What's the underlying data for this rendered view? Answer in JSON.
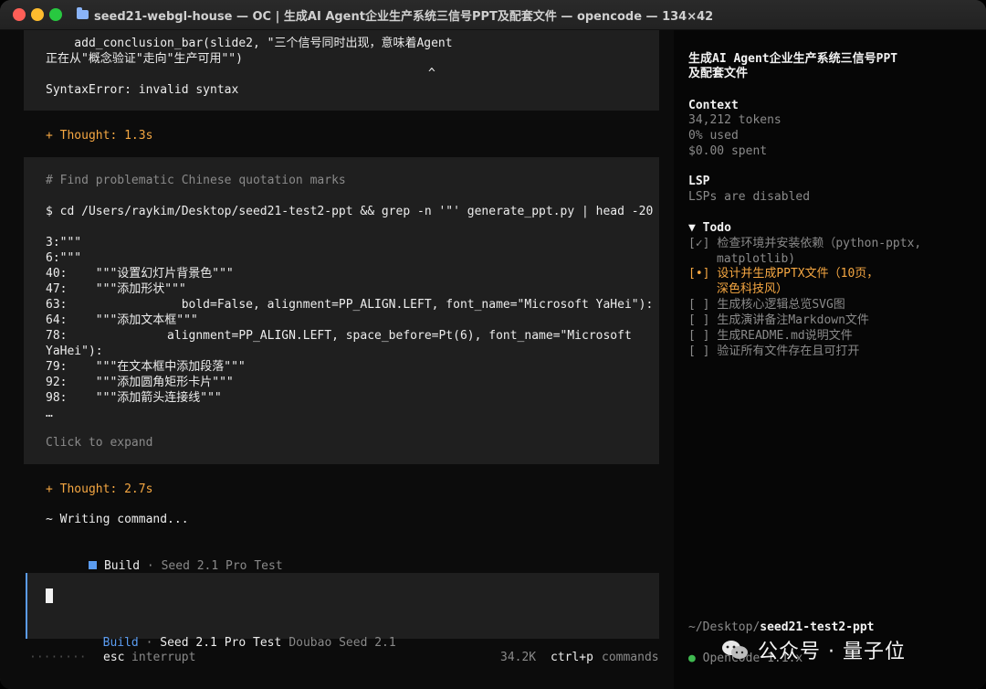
{
  "window": {
    "title": "seed21-webgl-house — OC | 生成AI Agent企业生产系统三信号PPT及配套文件 — opencode — 134×42"
  },
  "main": {
    "error_block": {
      "line1": "    add_conclusion_bar(slide2, \"三个信号同时出现，意味着Agent",
      "line2": "正在从\"概念验证\"走向\"生产可用\"\")",
      "caret": "^",
      "error": "SyntaxError: invalid syntax"
    },
    "thought1": "+ Thought: 1.3s",
    "cmd_block": {
      "comment": "# Find problematic Chinese quotation marks",
      "command": "$ cd /Users/raykim/Desktop/seed21-test2-ppt && grep -n '\"' generate_ppt.py | head -20",
      "out": [
        "3:\"\"\"",
        "6:\"\"\"",
        "40:    \"\"\"设置幻灯片背景色\"\"\"",
        "47:    \"\"\"添加形状\"\"\"",
        "63:                bold=False, alignment=PP_ALIGN.LEFT, font_name=\"Microsoft YaHei\"):",
        "64:    \"\"\"添加文本框\"\"\"",
        "78:              alignment=PP_ALIGN.LEFT, space_before=Pt(6), font_name=\"Microsoft",
        "YaHei\"):",
        "79:    \"\"\"在文本框中添加段落\"\"\"",
        "92:    \"\"\"添加圆角矩形卡片\"\"\"",
        "98:    \"\"\"添加箭头连接线\"\"\"",
        "…"
      ],
      "expand": "Click to expand"
    },
    "thought2": "+ Thought: 2.7s",
    "writing": "~ Writing command...",
    "build_line": {
      "label": "Build",
      "sep": " · ",
      "model": "Seed 2.1 Pro Test"
    },
    "input": {
      "mode": "Build",
      "sep": " · ",
      "model": "Seed 2.1 Pro Test",
      "provider": "Doubao Seed 2.1"
    },
    "status": {
      "dots": "········",
      "esc_key": "esc",
      "esc_label": "interrupt",
      "tokens": "34.2K",
      "cmd_key": "ctrl+p",
      "cmd_label": "commands"
    }
  },
  "sidebar": {
    "title1": "生成AI Agent企业生产系统三信号PPT",
    "title2": "及配套文件",
    "context_header": "Context",
    "context_tokens": "34,212 tokens",
    "context_used": "0% used",
    "context_spent": "$0.00 spent",
    "lsp_header": "LSP",
    "lsp_status": "LSPs are disabled",
    "todo_header": "▼ Todo",
    "todos": [
      {
        "mark": "[✓]",
        "text": "检查环境并安装依赖（python-pptx,",
        "cont": "matplotlib)"
      },
      {
        "mark": "[•]",
        "text": "设计并生成PPTX文件（10页，",
        "cont": "深色科技风）"
      },
      {
        "mark": "[ ]",
        "text": "生成核心逻辑总览SVG图",
        "cont": ""
      },
      {
        "mark": "[ ]",
        "text": "生成演讲备注Markdown文件",
        "cont": ""
      },
      {
        "mark": "[ ]",
        "text": "生成README.md说明文件",
        "cont": ""
      },
      {
        "mark": "[ ]",
        "text": "验证所有文件存在且可打开",
        "cont": ""
      }
    ],
    "path_prefix": "~/Desktop/",
    "path_dir": "seed21-test2-ppt",
    "footer_dot": "●",
    "footer_text": "OpenCode 1.1.x"
  },
  "watermark": {
    "text": "公众号 · 量子位"
  },
  "colors": {
    "accent": "#5b9cf0",
    "thought": "#f5a742",
    "muted": "#8a8a8a",
    "green": "#3fb950"
  }
}
